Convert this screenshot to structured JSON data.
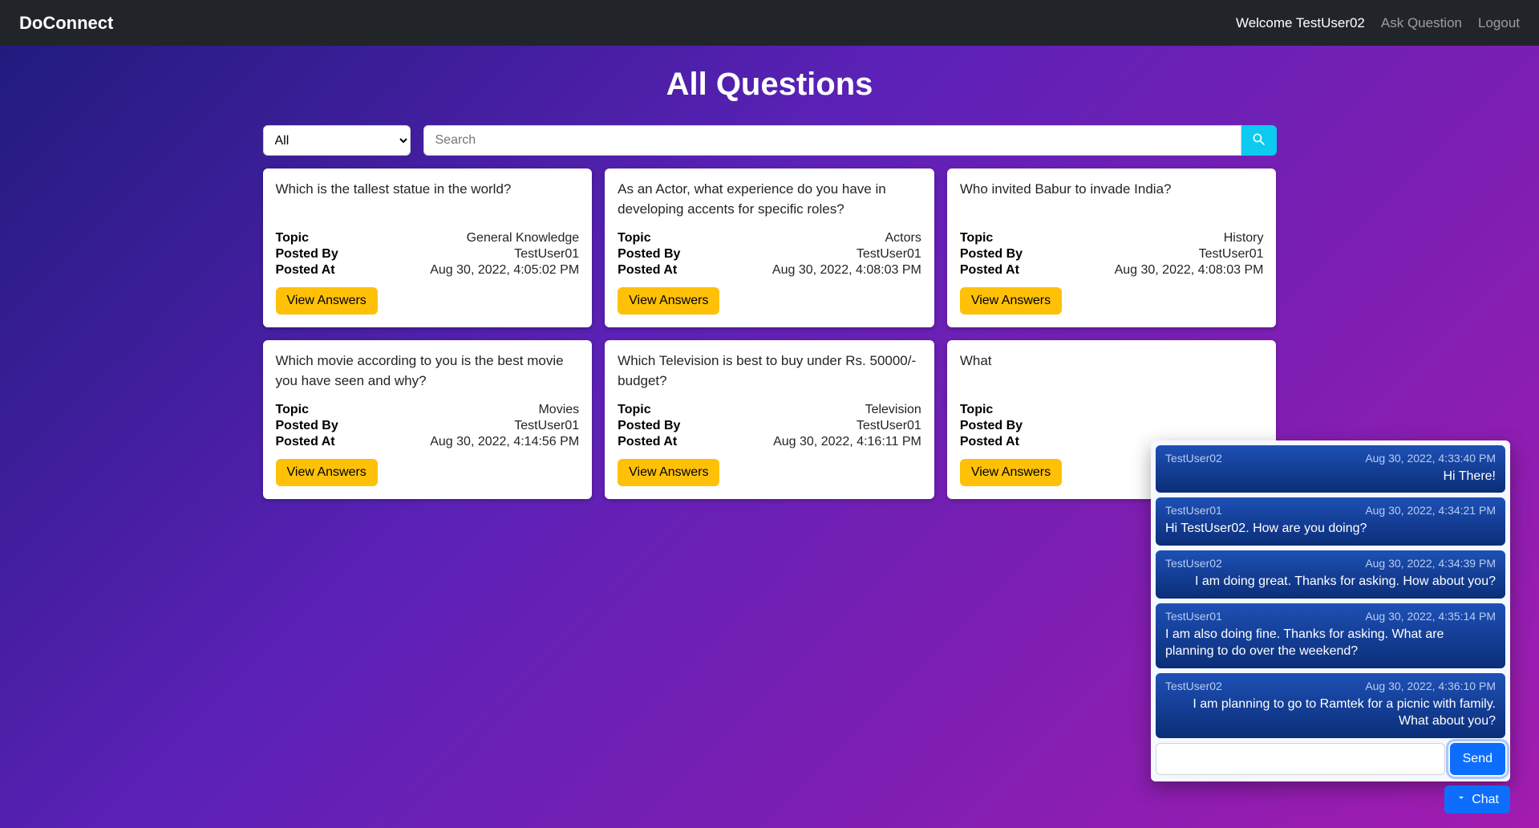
{
  "nav": {
    "brand": "DoConnect",
    "welcome": "Welcome TestUser02",
    "ask": "Ask Question",
    "logout": "Logout"
  },
  "page_title": "All Questions",
  "filter": {
    "selected": "All",
    "search_placeholder": "Search"
  },
  "labels": {
    "topic": "Topic",
    "posted_by": "Posted By",
    "posted_at": "Posted At",
    "view": "View Answers"
  },
  "questions": [
    {
      "text": "Which is the tallest statue in the world?",
      "topic": "General Knowledge",
      "by": "TestUser01",
      "at": "Aug 30, 2022, 4:05:02 PM"
    },
    {
      "text": "As an Actor, what experience do you have in developing accents for specific roles?",
      "topic": "Actors",
      "by": "TestUser01",
      "at": "Aug 30, 2022, 4:08:03 PM"
    },
    {
      "text": "Who invited Babur to invade India?",
      "topic": "History",
      "by": "TestUser01",
      "at": "Aug 30, 2022, 4:08:03 PM"
    },
    {
      "text": "Which movie according to you is the best movie you have seen and why?",
      "topic": "Movies",
      "by": "TestUser01",
      "at": "Aug 30, 2022, 4:14:56 PM"
    },
    {
      "text": "Which Television is best to buy under Rs. 50000/- budget?",
      "topic": "Television",
      "by": "TestUser01",
      "at": "Aug 30, 2022, 4:16:11 PM"
    },
    {
      "text": "What",
      "topic": "",
      "by": "",
      "at": ""
    }
  ],
  "chat": {
    "toggle_label": "Chat",
    "send_label": "Send",
    "messages": [
      {
        "user": "TestUser02",
        "time": "Aug 30, 2022, 4:33:40 PM",
        "text": "Hi There!",
        "align": "right"
      },
      {
        "user": "TestUser01",
        "time": "Aug 30, 2022, 4:34:21 PM",
        "text": "Hi TestUser02. How are you doing?",
        "align": "left"
      },
      {
        "user": "TestUser02",
        "time": "Aug 30, 2022, 4:34:39 PM",
        "text": "I am doing great. Thanks for asking. How about you?",
        "align": "right"
      },
      {
        "user": "TestUser01",
        "time": "Aug 30, 2022, 4:35:14 PM",
        "text": "I am also doing fine. Thanks for asking. What are planning to do over the weekend?",
        "align": "left"
      },
      {
        "user": "TestUser02",
        "time": "Aug 30, 2022, 4:36:10 PM",
        "text": "I am planning to go to Ramtek for a picnic with family. What about you?",
        "align": "right"
      }
    ]
  }
}
